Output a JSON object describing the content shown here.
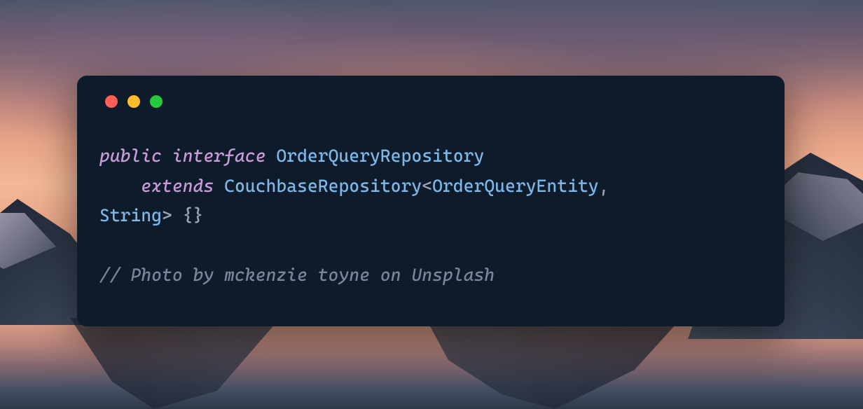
{
  "code": {
    "line1": {
      "kw_public": "public",
      "kw_interface": "interface",
      "class_name": "OrderQueryRepository"
    },
    "line2": {
      "indent": "    ",
      "kw_extends": "extends",
      "parent_type": "CouchbaseRepository",
      "bracket_open": "<",
      "generic1": "OrderQueryEntity",
      "comma": ","
    },
    "line3": {
      "generic2": "String",
      "bracket_close": ">",
      "body": " {}"
    },
    "comment": "// Photo by mckenzie toyne on Unsplash"
  },
  "window": {
    "close": "close",
    "minimize": "minimize",
    "maximize": "maximize"
  }
}
